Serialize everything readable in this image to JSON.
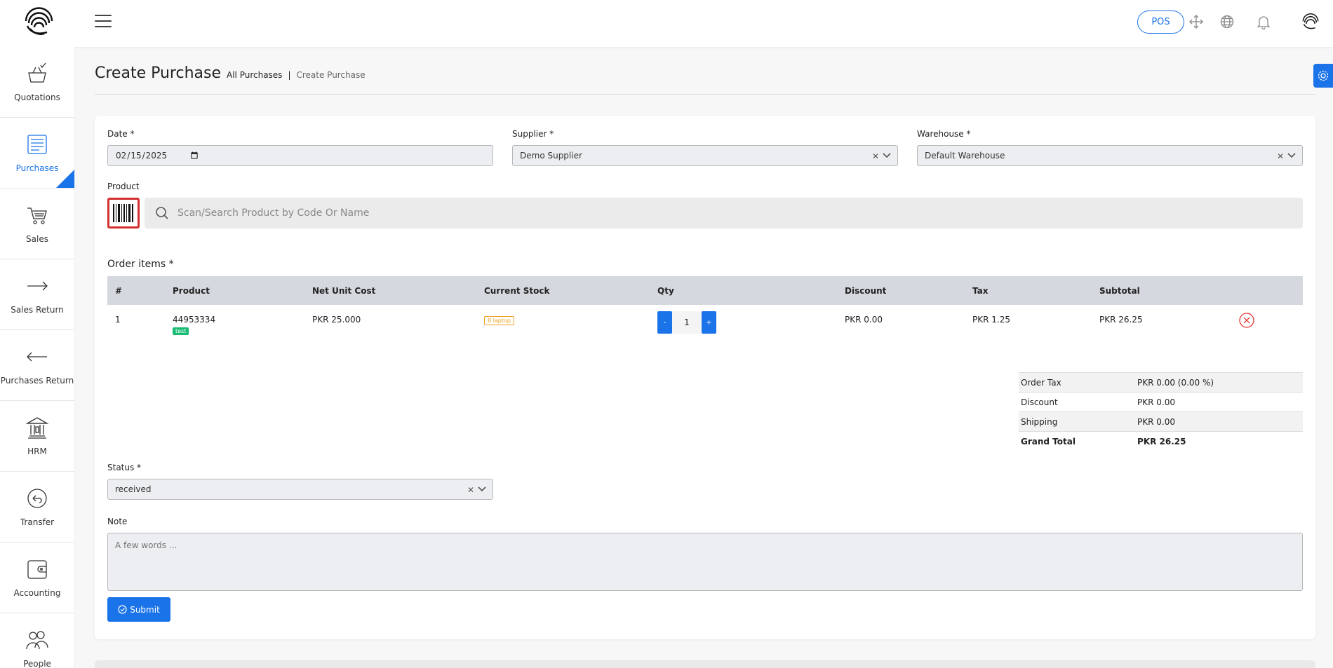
{
  "header": {
    "pos_label": "POS"
  },
  "sidebar": {
    "items": [
      {
        "label": "Quotations"
      },
      {
        "label": "Purchases"
      },
      {
        "label": "Sales"
      },
      {
        "label": "Sales Return"
      },
      {
        "label": "Purchases Return"
      },
      {
        "label": "HRM"
      },
      {
        "label": "Transfer"
      },
      {
        "label": "Accounting"
      },
      {
        "label": "People"
      }
    ],
    "active": "Purchases"
  },
  "page": {
    "title": "Create Purchase",
    "breadcrumb_all": "All Purchases",
    "breadcrumb_sep": "|",
    "breadcrumb_current": "Create Purchase"
  },
  "form": {
    "date_label": "Date *",
    "date_value": "2025-02-15",
    "supplier_label": "Supplier *",
    "supplier_value": "Demo Supplier",
    "warehouse_label": "Warehouse *",
    "warehouse_value": "Default Warehouse",
    "product_label": "Product",
    "search_placeholder": "Scan/Search Product by Code Or Name",
    "order_items_label": "Order items *",
    "status_label": "Status *",
    "status_value": "received",
    "note_label": "Note",
    "note_placeholder": "A few words ...",
    "submit_label": "Submit"
  },
  "table": {
    "columns": [
      "#",
      "Product",
      "Net Unit Cost",
      "Current Stock",
      "Qty",
      "Discount",
      "Tax",
      "Subtotal"
    ],
    "rows": [
      {
        "index": "1",
        "product_code": "44953334",
        "product_tag": "test",
        "net_unit_cost": "PKR 25.000",
        "current_stock": "8 laptop",
        "qty": "1",
        "qty_minus": "-",
        "qty_plus": "+",
        "discount": "PKR 0.00",
        "tax": "PKR 1.25",
        "subtotal": "PKR 26.25"
      }
    ]
  },
  "totals": {
    "order_tax_label": "Order Tax",
    "order_tax_value": "PKR 0.00 (0.00 %)",
    "discount_label": "Discount",
    "discount_value": "PKR 0.00",
    "shipping_label": "Shipping",
    "shipping_value": "PKR 0.00",
    "grand_total_label": "Grand Total",
    "grand_total_value": "PKR 26.25"
  },
  "colors": {
    "accent": "#1a73e8",
    "danger": "#d32f2f",
    "success": "#1abc74",
    "warning": "#f0a020"
  },
  "icons": [
    "logo-icon",
    "menu-icon",
    "fullscreen-icon",
    "globe-icon",
    "bell-icon",
    "avatar-icon",
    "gear-icon",
    "barcode-icon",
    "search-icon",
    "clear-icon",
    "chevron-down-icon",
    "remove-icon",
    "check-circle-icon"
  ]
}
